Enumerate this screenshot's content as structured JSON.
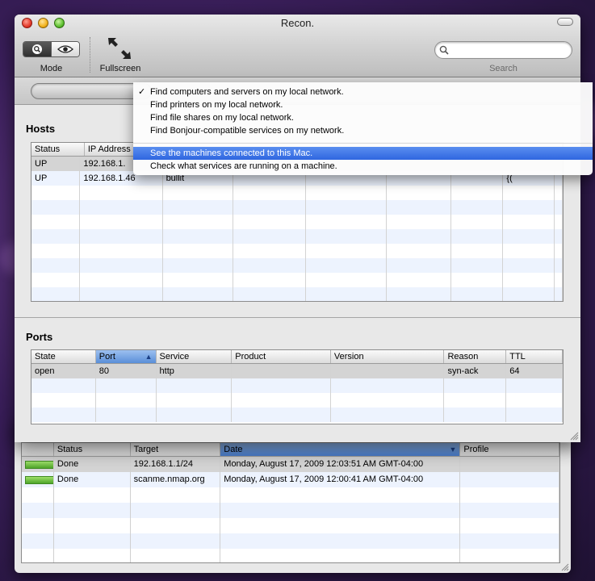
{
  "window": {
    "title": "Recon.",
    "toolbar": {
      "mode_label": "Mode",
      "fullscreen_label": "Fullscreen",
      "search_label": "Search",
      "search_value": "",
      "search_placeholder": ""
    }
  },
  "hosts": {
    "title": "Hosts",
    "columns": [
      "Status",
      "IP Address"
    ],
    "rows": [
      {
        "status": "UP",
        "ip": "192.168.1.",
        "extra": "",
        "tail": ""
      },
      {
        "status": "UP",
        "ip": "192.168.1.46",
        "extra": "bullit",
        "tail": "{("
      }
    ]
  },
  "ports": {
    "title": "Ports",
    "columns": [
      "State",
      "Port",
      "Service",
      "Product",
      "Version",
      "Reason",
      "TTL"
    ],
    "rows": [
      {
        "state": "open",
        "port": "80",
        "service": "http",
        "product": "",
        "version": "",
        "reason": "syn-ack",
        "ttl": "64"
      }
    ]
  },
  "menu": {
    "items": [
      {
        "label": "Find computers and servers on my local network.",
        "checked": true
      },
      {
        "label": "Find printers on my local network.",
        "checked": false
      },
      {
        "label": "Find file shares on my local network.",
        "checked": false
      },
      {
        "label": "Find Bonjour-compatible services on my network.",
        "checked": false
      },
      {
        "label": "See the machines connected to this Mac.",
        "checked": false,
        "highlighted": true
      },
      {
        "label": "Check what services are running on a machine.",
        "checked": false
      }
    ],
    "check_glyph": "✓"
  },
  "history": {
    "columns": [
      "Status",
      "Target",
      "Date",
      "Profile"
    ],
    "rows": [
      {
        "progress": 1.0,
        "status": "Done",
        "target": "192.168.1.1/24",
        "date": "Monday, August 17, 2009 12:03:51 AM GMT-04:00",
        "profile": ""
      },
      {
        "progress": 1.0,
        "status": "Done",
        "target": "scanme.nmap.org",
        "date": "Monday, August 17, 2009 12:00:41 AM GMT-04:00",
        "profile": ""
      }
    ]
  },
  "colors": {
    "highlight": "#2f66e0",
    "progress_green": "#4fa52a",
    "sort_header": "#5a8ed8"
  },
  "icons": [
    "magnifier-icon",
    "eye-icon",
    "fullscreen-arrows-icon",
    "search-icon",
    "sort-ascending-icon",
    "sort-descending-icon",
    "resize-grip-icon",
    "checkmark-icon"
  ]
}
